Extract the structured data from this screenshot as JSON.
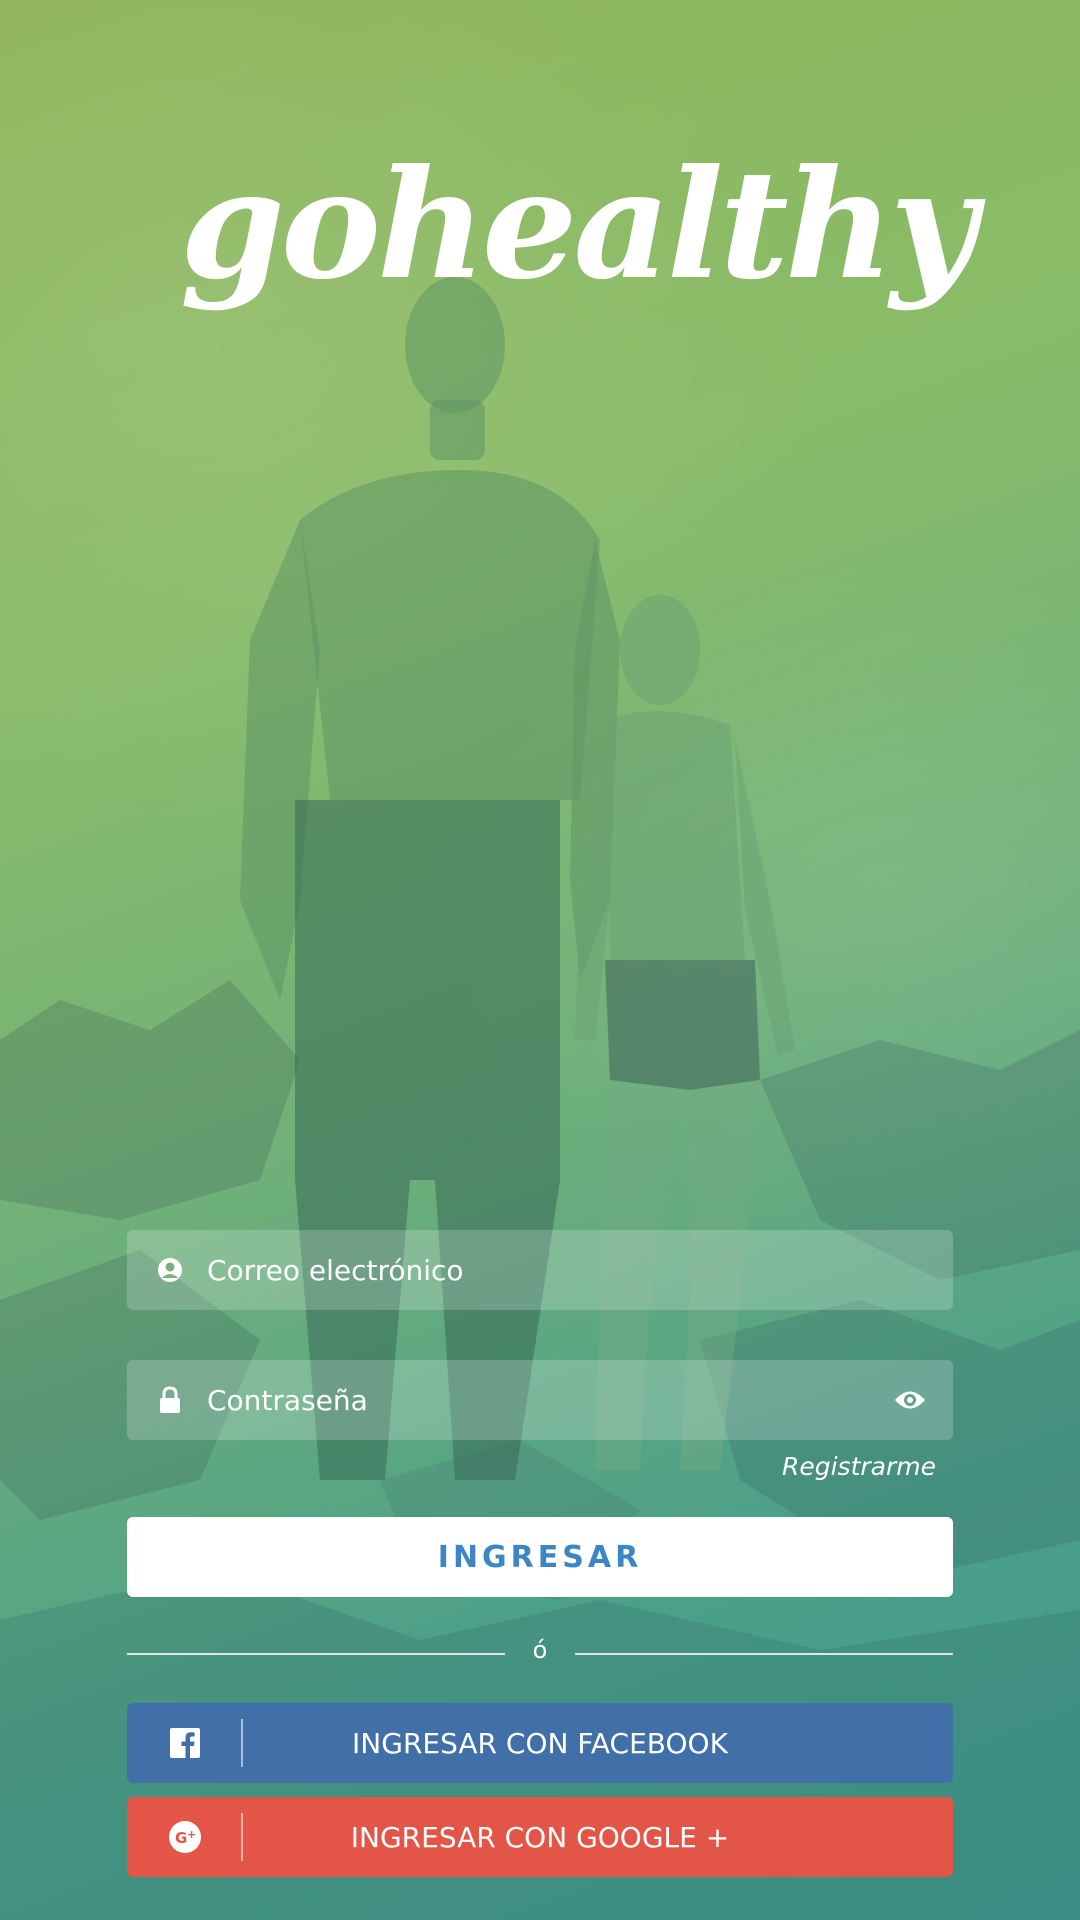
{
  "logo": {
    "text": "gohealthy"
  },
  "login_form": {
    "email_placeholder": "Correo electrónico",
    "password_placeholder": "Contraseña",
    "register_link": "Registrarme",
    "submit_label": "INGRESAR",
    "divider_text": "ó"
  },
  "social": {
    "facebook_label": "INGRESAR CON FACEBOOK",
    "google_label": "INGRESAR CON GOOGLE +"
  },
  "colors": {
    "facebook": "#4170a9",
    "google": "#e35547",
    "submit_text": "#3b86c4"
  },
  "icons": {
    "email": "user-circle-icon",
    "password": "lock-icon",
    "show_password": "eye-icon",
    "facebook": "facebook-icon",
    "google": "google-plus-icon"
  }
}
